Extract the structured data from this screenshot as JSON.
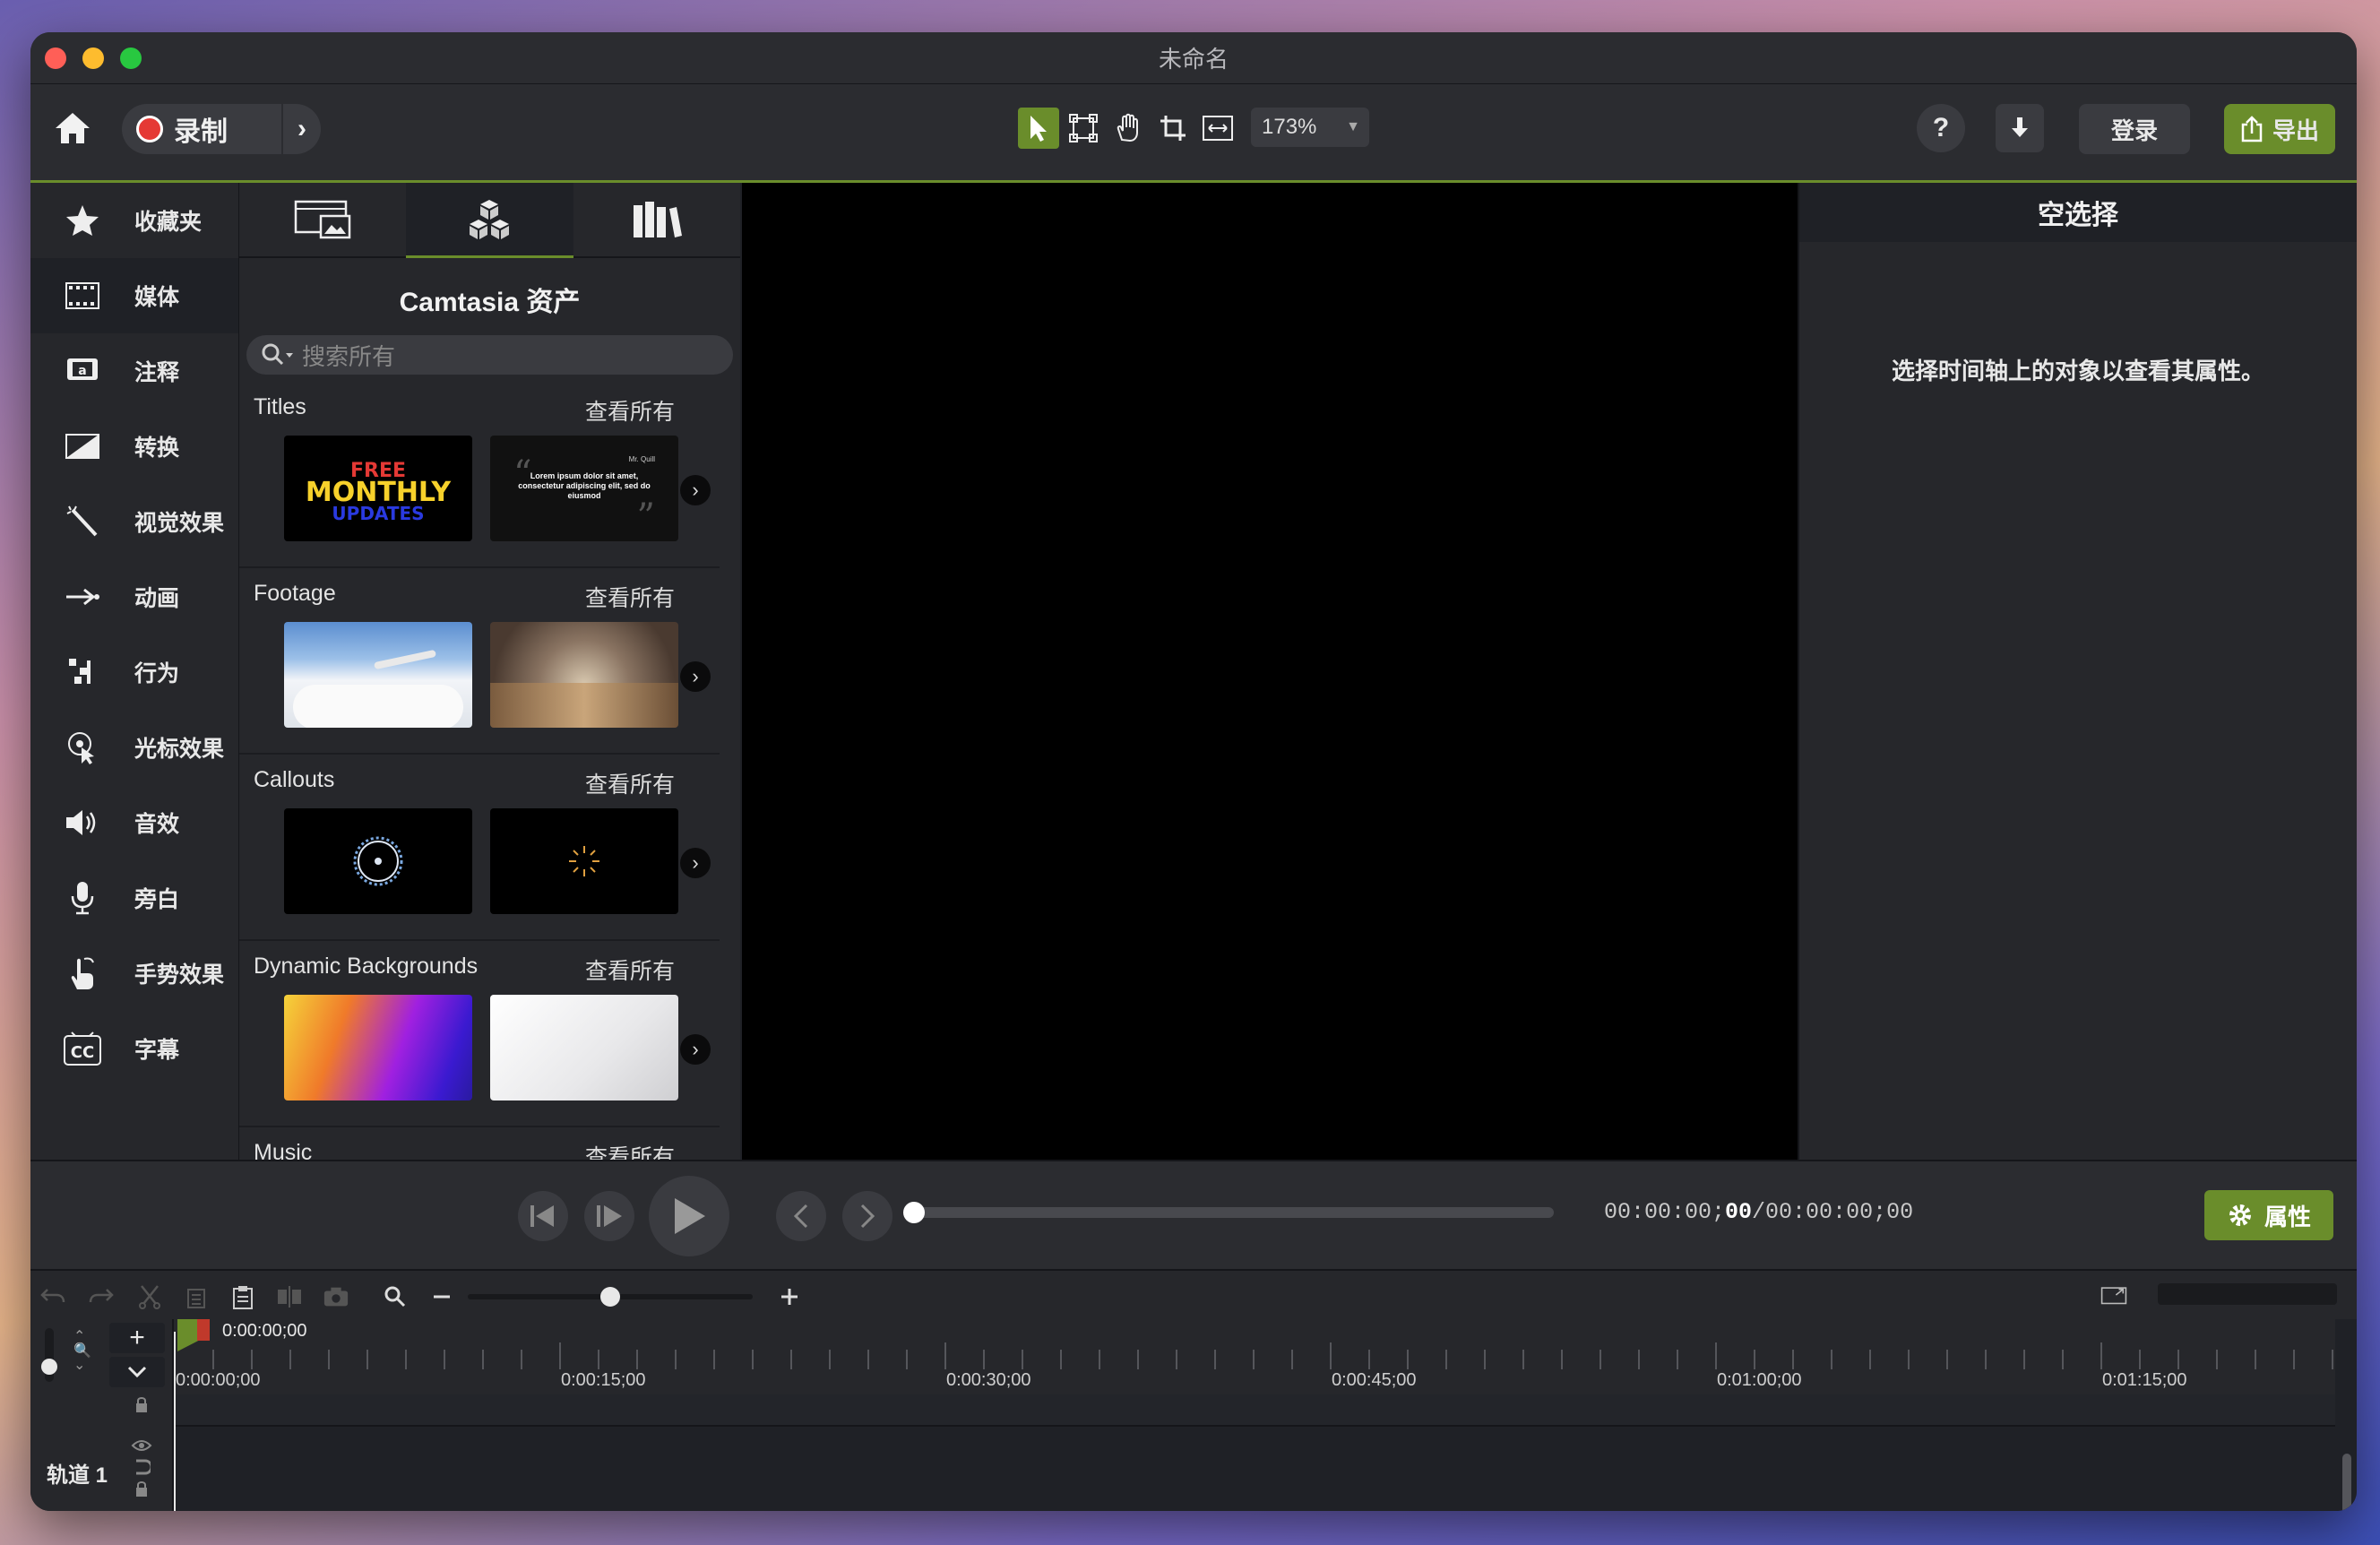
{
  "window": {
    "title": "未命名"
  },
  "colors": {
    "accent": "#6a8d2b",
    "record": "#e53935",
    "bg": "#1f2126"
  },
  "toolbar": {
    "record_label": "录制",
    "zoom_value": "173%",
    "help_label": "?",
    "login_label": "登录",
    "export_label": "导出",
    "tools": [
      "arrow-select-icon",
      "transform-icon",
      "pan-hand-icon",
      "crop-icon",
      "fit-icon"
    ]
  },
  "leftnav": {
    "items": [
      {
        "label": "收藏夹",
        "icon": "star-icon"
      },
      {
        "label": "媒体",
        "icon": "film-icon"
      },
      {
        "label": "注释",
        "icon": "annotation-icon"
      },
      {
        "label": "转换",
        "icon": "transition-icon"
      },
      {
        "label": "视觉效果",
        "icon": "magic-wand-icon"
      },
      {
        "label": "动画",
        "icon": "animation-arrow-icon"
      },
      {
        "label": "行为",
        "icon": "behavior-icon"
      },
      {
        "label": "光标效果",
        "icon": "cursor-effect-icon"
      },
      {
        "label": "音效",
        "icon": "speaker-icon"
      },
      {
        "label": "旁白",
        "icon": "microphone-icon"
      },
      {
        "label": "手势效果",
        "icon": "hand-gesture-icon"
      },
      {
        "label": "字幕",
        "icon": "cc-icon"
      }
    ]
  },
  "assets": {
    "title": "Camtasia 资产",
    "search_placeholder": "搜索所有",
    "sections": [
      {
        "name": "Titles",
        "view_all": "查看所有",
        "thumb1": {
          "line1": "FREE",
          "line2": "MONTHLY",
          "line3": "UPDATES"
        },
        "thumb2": {
          "quote": "Lorem ipsum dolor sit amet, consectetur adipiscing elit, sed do eiusmod",
          "author": "Mr. Quill"
        }
      },
      {
        "name": "Footage",
        "view_all": "查看所有"
      },
      {
        "name": "Callouts",
        "view_all": "查看所有"
      },
      {
        "name": "Dynamic Backgrounds",
        "view_all": "查看所有"
      },
      {
        "name": "Music",
        "view_all": "查看所有"
      }
    ]
  },
  "properties": {
    "header": "空选择",
    "message": "选择时间轴上的对象以查看其属性。",
    "button_label": "属性"
  },
  "playback": {
    "time_current_prefix": "00:00:00;",
    "time_current_frames": "00",
    "time_total": "/00:00:00;00"
  },
  "timeline": {
    "playhead_time": "0:00:00;00",
    "ruler_labels": [
      "0:00:00;00",
      "0:00:15;00",
      "0:00:30;00",
      "0:00:45;00",
      "0:01:00;00",
      "0:01:15;00"
    ],
    "track_name": "轨道 1"
  }
}
